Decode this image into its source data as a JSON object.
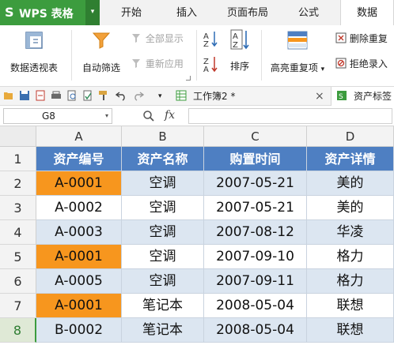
{
  "app": {
    "logo_glyph": "S",
    "name": "WPS 表格",
    "dropdown_glyph": "▾"
  },
  "menu_tabs": [
    "开始",
    "插入",
    "页面布局",
    "公式",
    "数据"
  ],
  "active_tab": "数据",
  "ribbon": {
    "pivot_table": "数据透视表",
    "auto_filter": "自动筛选",
    "show_all": "全部显示",
    "reapply": "重新应用",
    "sort": "排序",
    "highlight_dup": "高亮重复项",
    "highlight_dup_arrow": "▾",
    "delete_dup": "删除重复",
    "reject_dup": "拒绝录入"
  },
  "quick_access": {
    "doc_tab_label": "工作簿2 *",
    "close_glyph": "×",
    "second_doc_label": "资产标签",
    "dropdown_glyph": "▾"
  },
  "formula_bar": {
    "name_box": "G8",
    "name_box_arrow": "▾",
    "fx_label": "fx",
    "formula": ""
  },
  "grid": {
    "columns": [
      "A",
      "B",
      "C",
      "D"
    ],
    "selected_row": "8",
    "header_row": {
      "row": "1",
      "cells": [
        "资产编号",
        "资产名称",
        "购置时间",
        "资产详情"
      ]
    },
    "rows": [
      {
        "row": "2",
        "cells": [
          "A-0001",
          "空调",
          "2007-05-21",
          "美的"
        ],
        "a_highlight": true,
        "band": "alt"
      },
      {
        "row": "3",
        "cells": [
          "A-0002",
          "空调",
          "2007-05-21",
          "美的"
        ],
        "a_highlight": false,
        "band": "plain"
      },
      {
        "row": "4",
        "cells": [
          "A-0003",
          "空调",
          "2007-08-12",
          "华凌"
        ],
        "a_highlight": false,
        "band": "alt"
      },
      {
        "row": "5",
        "cells": [
          "A-0001",
          "空调",
          "2007-09-10",
          "格力"
        ],
        "a_highlight": true,
        "band": "plain"
      },
      {
        "row": "6",
        "cells": [
          "A-0005",
          "空调",
          "2007-09-11",
          "格力"
        ],
        "a_highlight": false,
        "band": "alt"
      },
      {
        "row": "7",
        "cells": [
          "A-0001",
          "笔记本",
          "2008-05-04",
          "联想"
        ],
        "a_highlight": true,
        "band": "plain"
      },
      {
        "row": "8",
        "cells": [
          "B-0002",
          "笔记本",
          "2008-05-04",
          "联想"
        ],
        "a_highlight": false,
        "band": "alt"
      }
    ]
  },
  "colors": {
    "brand_green": "#3c9c3e",
    "header_blue": "#4e7fc2",
    "band_blue": "#dce6f1",
    "duplicate_orange": "#f7961e"
  }
}
